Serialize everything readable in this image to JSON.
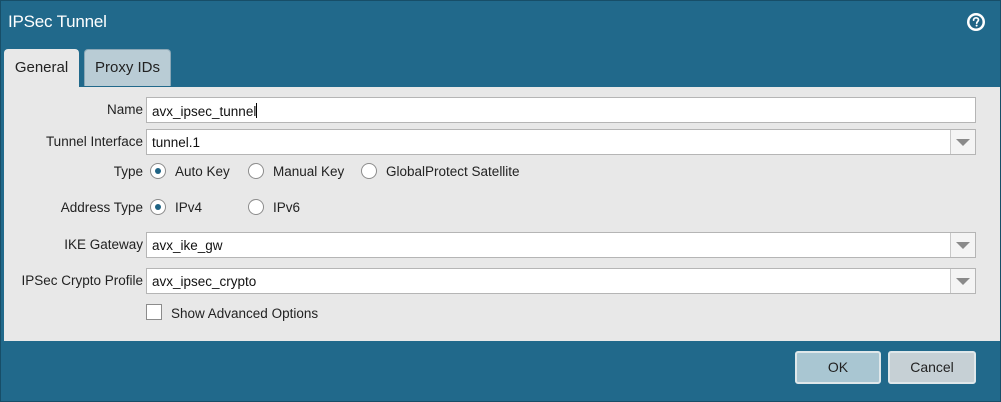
{
  "window": {
    "title": "IPSec Tunnel",
    "help_icon": "question-circle-icon"
  },
  "tabs": [
    {
      "label": "General",
      "active": true
    },
    {
      "label": "Proxy IDs",
      "active": false
    }
  ],
  "form": {
    "name": {
      "label": "Name",
      "value": "avx_ipsec_tunnel"
    },
    "tunnel_interface": {
      "label": "Tunnel Interface",
      "value": "tunnel.1"
    },
    "type": {
      "label": "Type",
      "options": [
        "Auto Key",
        "Manual Key",
        "GlobalProtect Satellite"
      ],
      "selected": "Auto Key"
    },
    "address_type": {
      "label": "Address Type",
      "options": [
        "IPv4",
        "IPv6"
      ],
      "selected": "IPv4"
    },
    "ike_gateway": {
      "label": "IKE Gateway",
      "value": "avx_ike_gw"
    },
    "ipsec_crypto_profile": {
      "label": "IPSec Crypto Profile",
      "value": "avx_ipsec_crypto"
    },
    "show_advanced": {
      "label": "Show Advanced Options",
      "checked": false
    }
  },
  "buttons": {
    "ok": "OK",
    "cancel": "Cancel"
  },
  "colors": {
    "frame": "#21698b",
    "panel": "#e8e8e8",
    "accent": "#1f6384"
  }
}
